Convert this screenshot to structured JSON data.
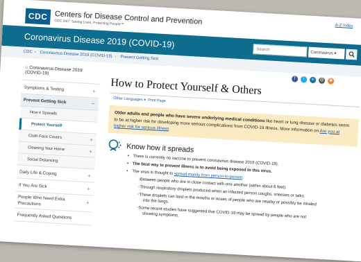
{
  "header": {
    "logo_text": "CDC",
    "org_name": "Centers for Disease Control and Prevention",
    "tagline": "CDC 24/7: Saving Lives, Protecting People™",
    "az_index": "A-Z Index"
  },
  "banner": {
    "title": "Coronavirus Disease 2019 (COVID-19)",
    "search_placeholder": "Search",
    "search_scope": "Coronavirus ▾",
    "search_icon": "magnifier-icon"
  },
  "breadcrumb": [
    "CDC",
    "Coronavirus Disease 2019 (COVID-19)",
    "Prevent Getting Sick"
  ],
  "sidebar": {
    "home": "Coronavirus Disease 2019 (COVID-19)",
    "items": [
      {
        "label": "Symptoms & Testing",
        "expand": "+"
      },
      {
        "label": "Prevent Getting Sick",
        "expand": "−"
      },
      {
        "label": "How it Spreads"
      },
      {
        "label": "Protect Yourself"
      },
      {
        "label": "Cloth Face Covers",
        "expand": "+"
      },
      {
        "label": "Cleaning Your Home",
        "expand": "+"
      },
      {
        "label": "Social Distancing"
      },
      {
        "label": "Daily Life & Coping",
        "expand": "+"
      },
      {
        "label": "If You Are Sick",
        "expand": "+"
      },
      {
        "label": "People Who Need Extra Precautions",
        "expand": "+"
      },
      {
        "label": "Frequently Asked Questions"
      }
    ]
  },
  "main": {
    "title": "How to Protect Yourself & Others",
    "other_languages": "Other Languages ▾",
    "print_page": "Print Page",
    "alert_bold": "Older adults and people who have severe underlying medical conditions",
    "alert_text": " like heart or lung disease or diabetes seem to be at higher risk for developing more serious complications from COVID-19 illness. More information on ",
    "alert_link": "Are you at higher risk for serious illness",
    "section_heading": "Know how it spreads",
    "bullets": {
      "b1": "There is currently no vaccine to prevent coronavirus disease 2019 (COVID-19).",
      "b2_bold": "The best way to prevent illness is to avoid being exposed to this virus.",
      "b3_pre": "The virus is thought to ",
      "b3_link": "spread mainly from person-to-person",
      "b3_post": ".",
      "s1": "Between people who are in close contact with one another (within about 6 feet).",
      "s2": "Through respiratory droplets produced when an infected person coughs, sneezes or talks.",
      "s3a": "These droplets can land in the mouths or noses of people who are nearby or possibly be inhaled",
      "s3b": "into the lungs.",
      "s4a": "Some recent studies have suggested that COVID-19 may be spread by people who are not",
      "s4b": "showing symptoms."
    }
  },
  "social": [
    {
      "icon": "facebook-icon",
      "glyph": "f",
      "color": "#3b5998"
    },
    {
      "icon": "twitter-icon",
      "glyph": "t",
      "color": "#1da1f2"
    },
    {
      "icon": "linkedin-icon",
      "glyph": "in",
      "color": "#0e76a8"
    },
    {
      "icon": "email-icon",
      "glyph": "@",
      "color": "#555555"
    },
    {
      "icon": "rss-icon",
      "glyph": "◉",
      "color": "#ee802f"
    }
  ],
  "colors": {
    "banner": "#0e6c8f",
    "alert": "#fbebc3",
    "link": "#1a5ba6"
  }
}
